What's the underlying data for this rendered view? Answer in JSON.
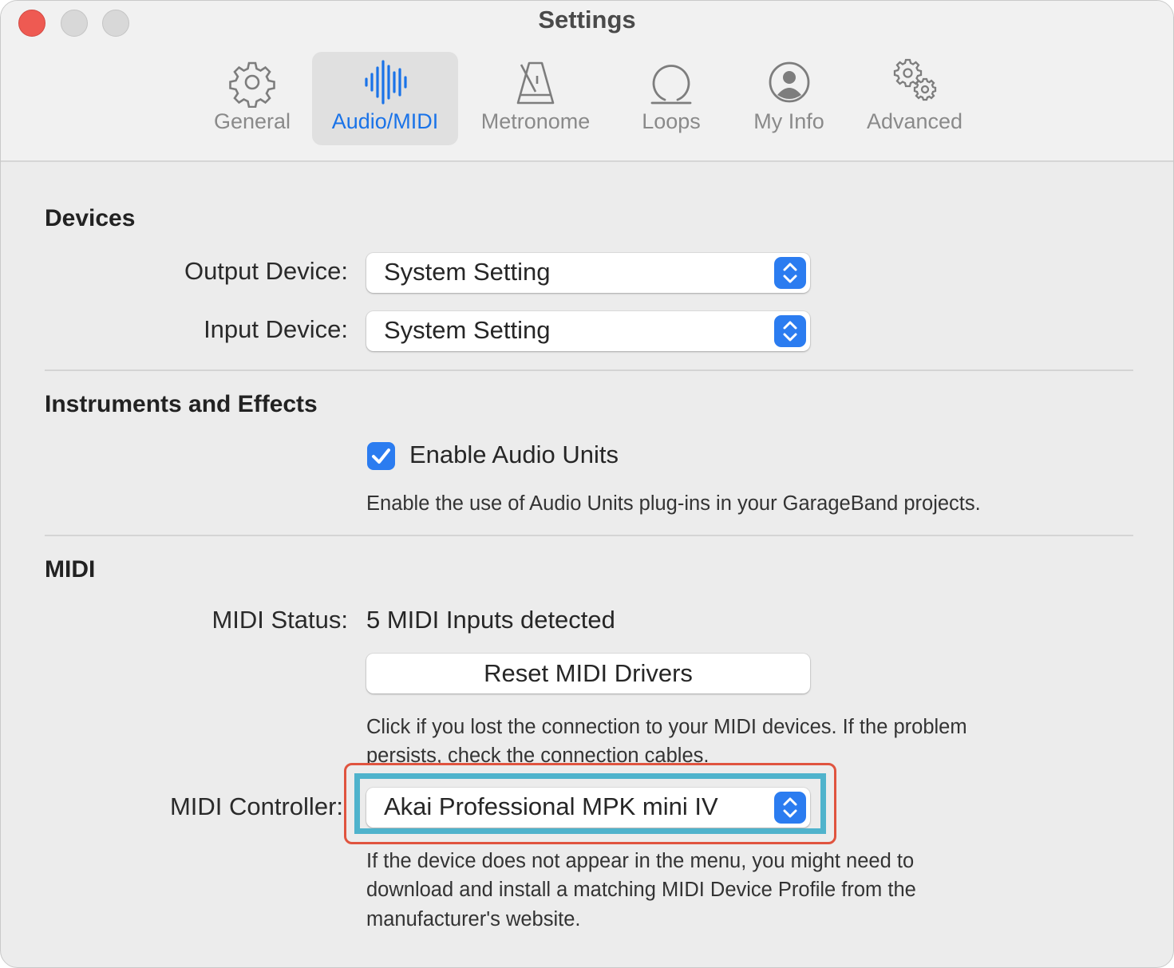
{
  "window": {
    "title": "Settings"
  },
  "tabs": [
    {
      "label": "General",
      "icon": "gear-icon"
    },
    {
      "label": "Audio/MIDI",
      "icon": "waveform-icon",
      "active": true
    },
    {
      "label": "Metronome",
      "icon": "metronome-icon"
    },
    {
      "label": "Loops",
      "icon": "loop-icon"
    },
    {
      "label": "My Info",
      "icon": "person-icon"
    },
    {
      "label": "Advanced",
      "icon": "gears-icon"
    }
  ],
  "devices": {
    "title": "Devices",
    "output_label": "Output Device:",
    "output_value": "System Setting",
    "input_label": "Input Device:",
    "input_value": "System Setting"
  },
  "instruments": {
    "title": "Instruments and Effects",
    "checkbox_label": "Enable Audio Units",
    "checkbox_checked": true,
    "help": "Enable the use of Audio Units plug-ins in your GarageBand projects."
  },
  "midi": {
    "title": "MIDI",
    "status_label": "MIDI Status:",
    "status_value": "5 MIDI Inputs detected",
    "reset_button": "Reset MIDI Drivers",
    "reset_help_line1": "Click if you lost the connection to your MIDI devices. If the problem",
    "reset_help_line2": "persists, check the connection cables.",
    "controller_label": "MIDI Controller:",
    "controller_value": "Akai Professional MPK mini IV",
    "controller_help_line1": "If the device does not appear in the menu, you might need to",
    "controller_help_line2": "download and install a matching MIDI Device Profile from the",
    "controller_help_line3": "manufacturer's website."
  },
  "colors": {
    "accent": "#2b7cf0",
    "highlight_outer": "#e0543f",
    "highlight_inner": "#4fb3cc"
  }
}
